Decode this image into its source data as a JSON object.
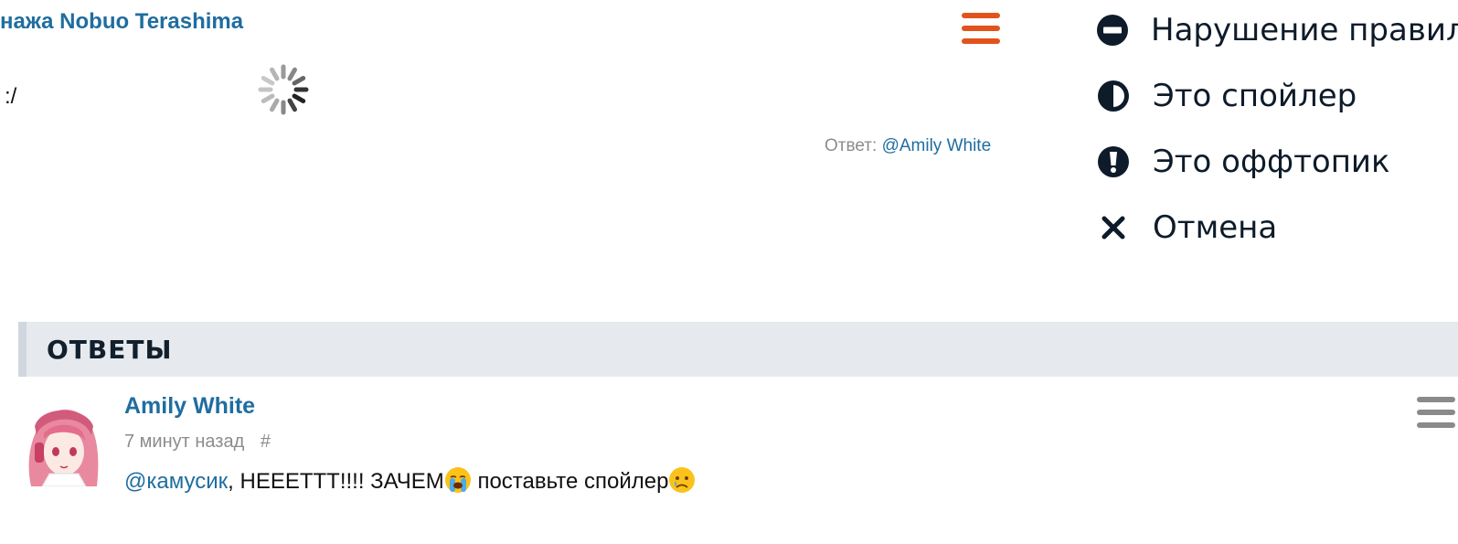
{
  "post": {
    "title_fragment": "нажа Nobuo Terashima",
    "text": ":/",
    "reply_label": "Ответ:",
    "reply_mention": "@Amily White"
  },
  "report_menu": {
    "items": [
      {
        "label": "Нарушение правил",
        "icon": "no-entry-icon"
      },
      {
        "label": "Это спойлер",
        "icon": "half-circle-icon"
      },
      {
        "label": "Это оффтопик",
        "icon": "exclamation-icon"
      },
      {
        "label": "Отмена",
        "icon": "close-icon"
      }
    ]
  },
  "answers": {
    "heading": "ОТВЕТЫ",
    "comments": [
      {
        "author": "Amily White",
        "time": "7 минут назад",
        "permalink": "#",
        "mention": "@камусик",
        "text": ", НЕЕЕТТТ!!!! ЗАЧЕМ",
        "text_after": " поставьте спойлер"
      }
    ]
  },
  "colors": {
    "link": "#1f6da0",
    "accent_menu": "#e2531c",
    "header_bg": "#e6eaef",
    "muted": "#8c8c8c"
  }
}
